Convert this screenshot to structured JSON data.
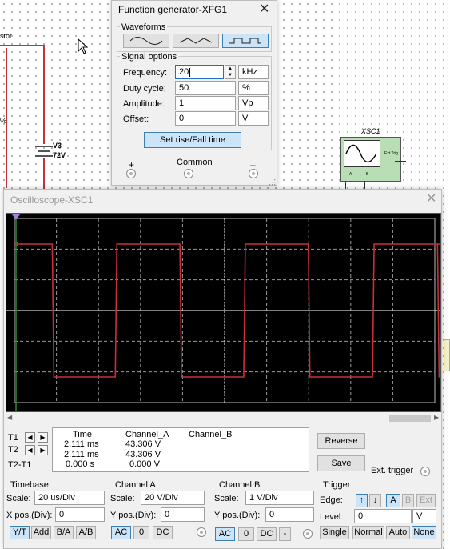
{
  "schematic": {
    "label_fragment": "stor",
    "pct_fragment": "%",
    "source_name": "V3",
    "source_value": "72V",
    "scope_name": "XSC1",
    "scope_ext_trig": "Ext Trig",
    "scope_terms": [
      "A",
      "B"
    ]
  },
  "function_generator": {
    "title": "Function generator-XFG1",
    "waveforms_label": "Waveforms",
    "waveforms": [
      "sine",
      "triangle",
      "square"
    ],
    "selected_waveform": "square",
    "signal_options_label": "Signal options",
    "frequency_label": "Frequency:",
    "frequency_value": "20",
    "frequency_unit": "kHz",
    "duty_label": "Duty cycle:",
    "duty_value": "50",
    "duty_unit": "%",
    "amplitude_label": "Amplitude:",
    "amplitude_value": "1",
    "amplitude_unit": "Vp",
    "offset_label": "Offset:",
    "offset_value": "0",
    "offset_unit": "V",
    "rise_fall_button": "Set rise/Fall time",
    "plus_label": "+",
    "common_label": "Common",
    "minus_label": "–"
  },
  "oscilloscope": {
    "title": "Oscilloscope-XSC1",
    "readout": {
      "headers": [
        "Time",
        "Channel_A",
        "Channel_B"
      ],
      "rows": [
        {
          "label": "T1",
          "time": "2.111 ms",
          "a": "43.306 V",
          "b": ""
        },
        {
          "label": "T2",
          "time": "2.111 ms",
          "a": "43.306 V",
          "b": ""
        },
        {
          "label": "T2-T1",
          "time": "0.000 s",
          "a": "0.000 V",
          "b": ""
        }
      ]
    },
    "reverse_button": "Reverse",
    "save_button": "Save",
    "ext_trigger_label": "Ext. trigger",
    "timebase": {
      "label": "Timebase",
      "scale_label": "Scale:",
      "scale_value": "20 us/Div",
      "xpos_label": "X pos.(Div):",
      "xpos_value": "0",
      "buttons": [
        "Y/T",
        "Add",
        "B/A",
        "A/B"
      ],
      "active": "Y/T"
    },
    "channel_a": {
      "label": "Channel A",
      "scale_label": "Scale:",
      "scale_value": "20  V/Div",
      "ypos_label": "Y pos.(Div):",
      "ypos_value": "0",
      "buttons": [
        "AC",
        "0",
        "DC"
      ],
      "active": "AC"
    },
    "channel_b": {
      "label": "Channel B",
      "scale_label": "Scale:",
      "scale_value": "1  V/Div",
      "ypos_label": "Y pos.(Div):",
      "ypos_value": "0",
      "buttons": [
        "AC",
        "0",
        "DC",
        "-"
      ],
      "active": "AC"
    },
    "trigger": {
      "label": "Trigger",
      "edge_label": "Edge:",
      "edge_buttons": [
        "↑",
        "↓"
      ],
      "source_buttons": [
        "A",
        "B",
        "Ext"
      ],
      "active_source": "A",
      "level_label": "Level:",
      "level_value": "0",
      "level_unit": "V",
      "mode_buttons": [
        "Single",
        "Normal",
        "Auto",
        "None"
      ],
      "active_mode": "None"
    },
    "trace": {
      "color": "#c8303a",
      "high_level": 43.306,
      "low_level": -43.306,
      "transitions_div": [
        1.0,
        2.63,
        4.3,
        5.95,
        7.62,
        9.28,
        10.96,
        12.6
      ],
      "initial_high": true
    }
  }
}
